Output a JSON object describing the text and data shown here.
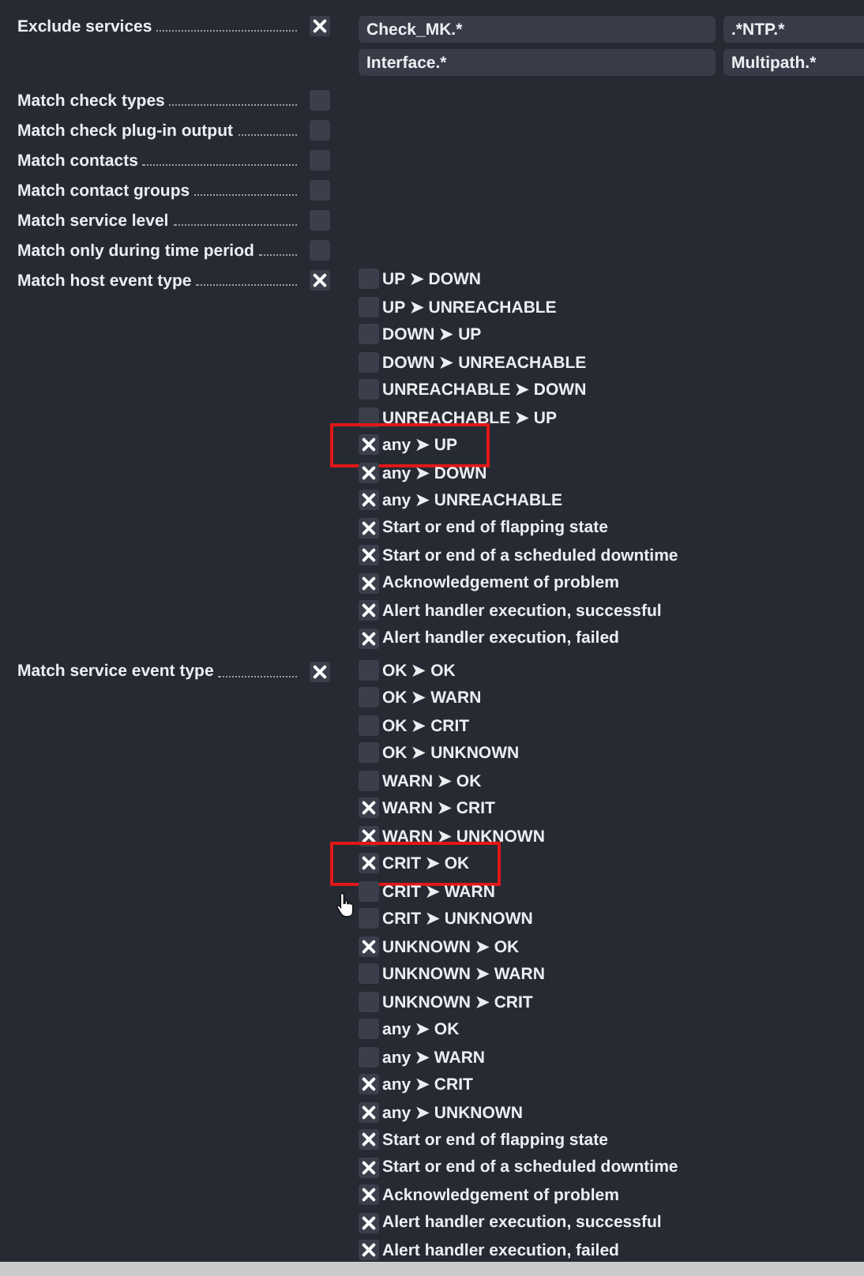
{
  "sections": [
    {
      "label": "Exclude services",
      "checked": true,
      "kind": "fields",
      "values": [
        "Check_MK.*",
        ".*NTP.*",
        "Interface.*",
        "Multipath.*"
      ]
    },
    {
      "label": "Match check types",
      "checked": false,
      "kind": "none"
    },
    {
      "label": "Match check plug-in output",
      "checked": false,
      "kind": "none"
    },
    {
      "label": "Match contacts",
      "checked": false,
      "kind": "none"
    },
    {
      "label": "Match contact groups",
      "checked": false,
      "kind": "none"
    },
    {
      "label": "Match service level",
      "checked": false,
      "kind": "none"
    },
    {
      "label": "Match only during time period",
      "checked": false,
      "kind": "none"
    },
    {
      "label": "Match host event type",
      "checked": true,
      "kind": "events",
      "events": [
        {
          "label": "UP ➤ DOWN",
          "checked": false
        },
        {
          "label": "UP ➤ UNREACHABLE",
          "checked": false
        },
        {
          "label": "DOWN ➤ UP",
          "checked": false
        },
        {
          "label": "DOWN ➤ UNREACHABLE",
          "checked": false
        },
        {
          "label": "UNREACHABLE ➤ DOWN",
          "checked": false
        },
        {
          "label": "UNREACHABLE ➤ UP",
          "checked": false
        },
        {
          "label": "any ➤ UP",
          "checked": true,
          "highlighted": true
        },
        {
          "label": "any ➤ DOWN",
          "checked": true
        },
        {
          "label": "any ➤ UNREACHABLE",
          "checked": true
        },
        {
          "label": "Start or end of flapping state",
          "checked": true
        },
        {
          "label": "Start or end of a scheduled downtime",
          "checked": true
        },
        {
          "label": "Acknowledgement of problem",
          "checked": true
        },
        {
          "label": "Alert handler execution, successful",
          "checked": true
        },
        {
          "label": "Alert handler execution, failed",
          "checked": true
        }
      ]
    },
    {
      "label": "Match service event type",
      "checked": true,
      "kind": "events",
      "events": [
        {
          "label": "OK ➤ OK",
          "checked": false
        },
        {
          "label": "OK ➤ WARN",
          "checked": false
        },
        {
          "label": "OK ➤ CRIT",
          "checked": false
        },
        {
          "label": "OK ➤ UNKNOWN",
          "checked": false
        },
        {
          "label": "WARN ➤ OK",
          "checked": false
        },
        {
          "label": "WARN ➤ CRIT",
          "checked": true
        },
        {
          "label": "WARN ➤ UNKNOWN",
          "checked": true
        },
        {
          "label": "CRIT ➤ OK",
          "checked": true,
          "highlighted": true
        },
        {
          "label": "CRIT ➤ WARN",
          "checked": false,
          "cursor": true
        },
        {
          "label": "CRIT ➤ UNKNOWN",
          "checked": false
        },
        {
          "label": "UNKNOWN ➤ OK",
          "checked": true
        },
        {
          "label": "UNKNOWN ➤ WARN",
          "checked": false
        },
        {
          "label": "UNKNOWN ➤ CRIT",
          "checked": false
        },
        {
          "label": "any ➤ OK",
          "checked": false
        },
        {
          "label": "any ➤ WARN",
          "checked": false
        },
        {
          "label": "any ➤ CRIT",
          "checked": true
        },
        {
          "label": "any ➤ UNKNOWN",
          "checked": true
        },
        {
          "label": "Start or end of flapping state",
          "checked": true
        },
        {
          "label": "Start or end of a scheduled downtime",
          "checked": true
        },
        {
          "label": "Acknowledgement of problem",
          "checked": true
        },
        {
          "label": "Alert handler execution, successful",
          "checked": true
        },
        {
          "label": "Alert handler execution, failed",
          "checked": true
        }
      ]
    }
  ]
}
